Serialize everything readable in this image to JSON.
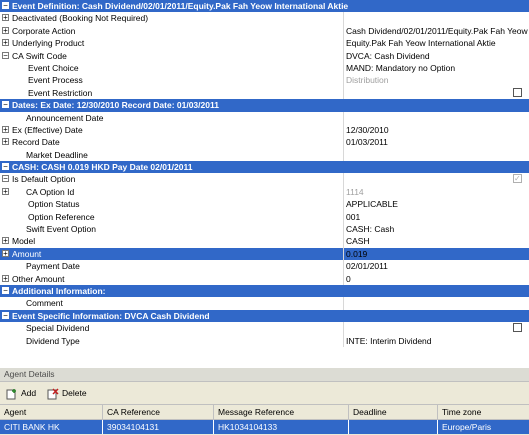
{
  "grid": {
    "rows": [
      {
        "kind": "section",
        "toggle": "−",
        "label": "Event Definition: Cash Dividend/02/01/2011/Equity.Pak Fah Yeow International Aktie"
      },
      {
        "kind": "field",
        "toggle": "+",
        "indent": 0,
        "label": "Deactivated (Booking Not Required)",
        "value": ""
      },
      {
        "kind": "field",
        "toggle": "+",
        "indent": 0,
        "label": "Corporate Action",
        "value": "Cash Dividend/02/01/2011/Equity.Pak Fah Yeow"
      },
      {
        "kind": "field",
        "toggle": "+",
        "indent": 0,
        "label": "Underlying Product",
        "value": "Equity.Pak Fah Yeow International Aktie"
      },
      {
        "kind": "field",
        "toggle": "−",
        "indent": 0,
        "label": "CA Swift Code",
        "value": "DVCA: Cash Dividend"
      },
      {
        "kind": "field",
        "toggle": "",
        "indent": 2,
        "label": "Event Choice",
        "value": "MAND: Mandatory no Option"
      },
      {
        "kind": "field",
        "toggle": "",
        "indent": 2,
        "label": "Event Process",
        "value": "Distribution",
        "gray": true
      },
      {
        "kind": "field",
        "toggle": "",
        "indent": 2,
        "label": "Event Restriction",
        "value": "",
        "checkbox": "unchecked"
      },
      {
        "kind": "section",
        "toggle": "−",
        "label": "Dates:  Ex Date: 12/30/2010 Record Date: 01/03/2011"
      },
      {
        "kind": "field",
        "toggle": "",
        "indent": 1,
        "label": "Announcement Date",
        "value": ""
      },
      {
        "kind": "field",
        "toggle": "+",
        "indent": 0,
        "label": "Ex (Effective) Date",
        "value": "12/30/2010"
      },
      {
        "kind": "field",
        "toggle": "+",
        "indent": 0,
        "label": "Record Date",
        "value": "01/03/2011"
      },
      {
        "kind": "field",
        "toggle": "",
        "indent": 1,
        "label": "Market Deadline",
        "value": ""
      },
      {
        "kind": "section",
        "toggle": "−",
        "label": "CASH: CASH 0.019  HKD Pay Date 02/01/2011"
      },
      {
        "kind": "field",
        "toggle": "−",
        "indent": 0,
        "label": "Is Default Option",
        "value": "",
        "checkbox": "checked"
      },
      {
        "kind": "field",
        "toggle": "+",
        "indent": 1,
        "label": "CA Option Id",
        "value": "1114",
        "gray": true
      },
      {
        "kind": "field",
        "toggle": "",
        "indent": 2,
        "label": "Option Status",
        "value": "APPLICABLE"
      },
      {
        "kind": "field",
        "toggle": "",
        "indent": 2,
        "label": "Option Reference",
        "value": "001"
      },
      {
        "kind": "field",
        "toggle": "",
        "indent": 1,
        "label": "Swift Event Option",
        "value": "CASH: Cash"
      },
      {
        "kind": "field",
        "toggle": "+",
        "indent": 0,
        "label": "Model",
        "value": "CASH"
      },
      {
        "kind": "field",
        "toggle": "+",
        "indent": 0,
        "label": "Amount",
        "value": "0.019",
        "highlight": true
      },
      {
        "kind": "field",
        "toggle": "",
        "indent": 1,
        "label": "Payment Date",
        "value": "02/01/2011"
      },
      {
        "kind": "field",
        "toggle": "+",
        "indent": 0,
        "label": "Other Amount",
        "value": "0"
      },
      {
        "kind": "section",
        "toggle": "−",
        "label": "Additional Information:"
      },
      {
        "kind": "field",
        "toggle": "",
        "indent": 1,
        "label": "Comment",
        "value": ""
      },
      {
        "kind": "section",
        "toggle": "−",
        "label": "Event Specific Information: DVCA Cash Dividend"
      },
      {
        "kind": "field",
        "toggle": "",
        "indent": 1,
        "label": "Special Dividend",
        "value": "",
        "checkbox": "unchecked"
      },
      {
        "kind": "field",
        "toggle": "",
        "indent": 1,
        "label": "Dividend Type",
        "value": "INTE: Interim Dividend"
      }
    ]
  },
  "agent": {
    "title": "Agent Details",
    "add_label": "Add",
    "delete_label": "Delete",
    "columns": [
      "Agent",
      "CA Reference",
      "Message Reference",
      "Deadline",
      "Time zone"
    ],
    "rows": [
      [
        "CITI BANK HK",
        "39034104131",
        "HK1034104133",
        "",
        "Europe/Paris"
      ]
    ]
  },
  "colors": {
    "accent": "#3168c8",
    "panel": "#ece9d8"
  }
}
